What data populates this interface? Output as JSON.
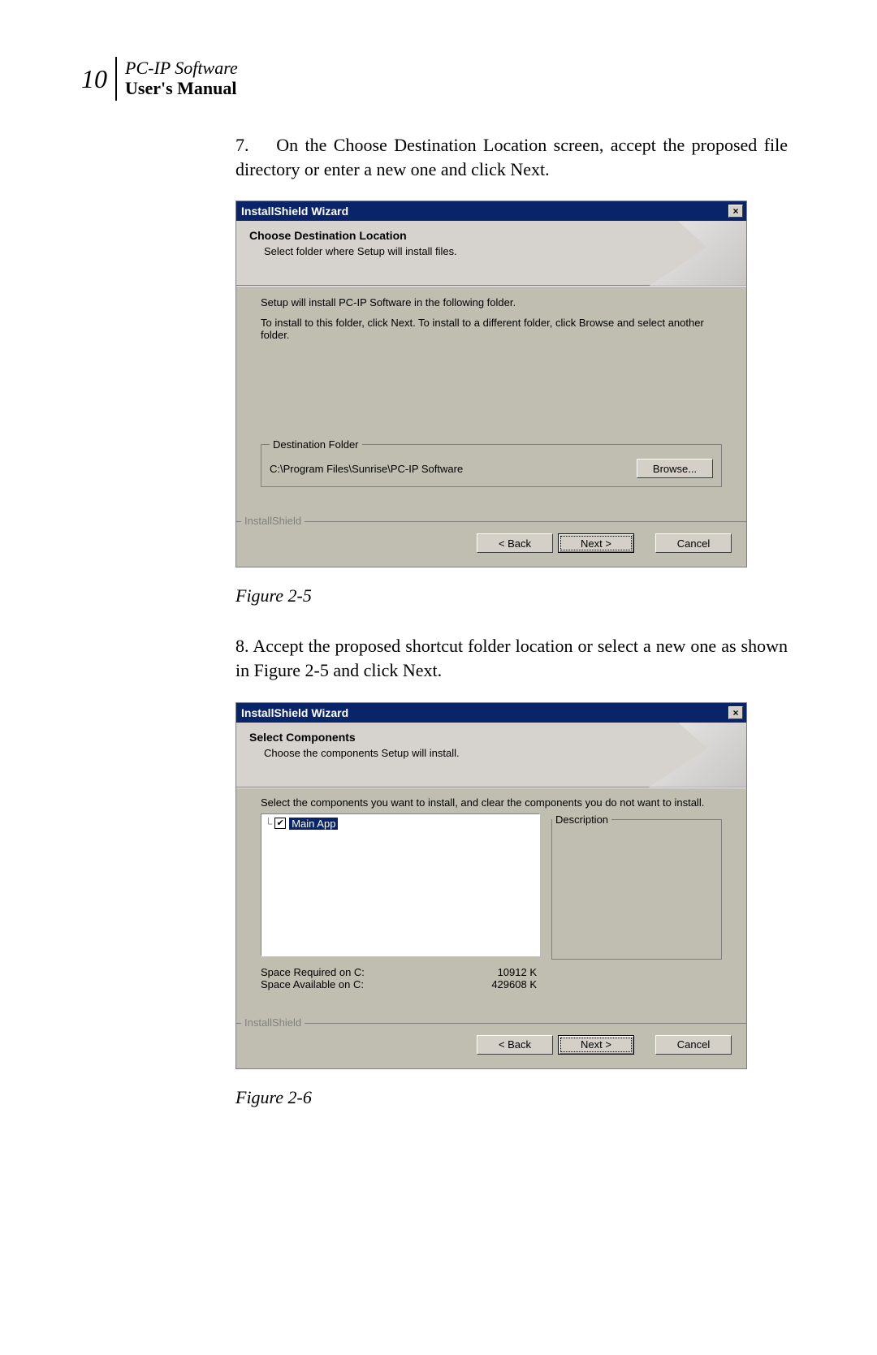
{
  "header": {
    "page_number": "10",
    "software_line": "PC-IP Software",
    "manual_line": "User's Manual"
  },
  "step7": {
    "num": "7.",
    "text": "On the Choose Destination Location screen, accept the proposed file directory or enter a new one and click Next."
  },
  "installer1": {
    "title": "InstallShield Wizard",
    "header_title": "Choose Destination Location",
    "header_sub": "Select folder where Setup will install files.",
    "line1": "Setup will install PC-IP Software in the following folder.",
    "line2": "To install to this folder, click Next. To install to a different folder, click Browse and select another folder.",
    "group_legend": "Destination Folder",
    "dest_path": "C:\\Program Files\\Sunrise\\PC-IP Software",
    "browse": "Browse...",
    "brand": "InstallShield",
    "back": "< Back",
    "next": "Next >",
    "cancel": "Cancel"
  },
  "fig5": "Figure 2-5",
  "step8": {
    "num": "8.",
    "text": "Accept the proposed shortcut folder location or select a new one as shown in Figure 2-5  and click Next."
  },
  "installer2": {
    "title": "InstallShield Wizard",
    "header_title": "Select Components",
    "header_sub": "Choose the components Setup will install.",
    "instr": "Select the components you want to install, and clear the components you do not want to install.",
    "component": "Main App",
    "desc_legend": "Description",
    "space_req_label": "Space Required on  C:",
    "space_req_val": "10912 K",
    "space_avail_label": "Space Available on  C:",
    "space_avail_val": "429608 K",
    "brand": "InstallShield",
    "back": "< Back",
    "next": "Next >",
    "cancel": "Cancel"
  },
  "fig6": "Figure 2-6"
}
